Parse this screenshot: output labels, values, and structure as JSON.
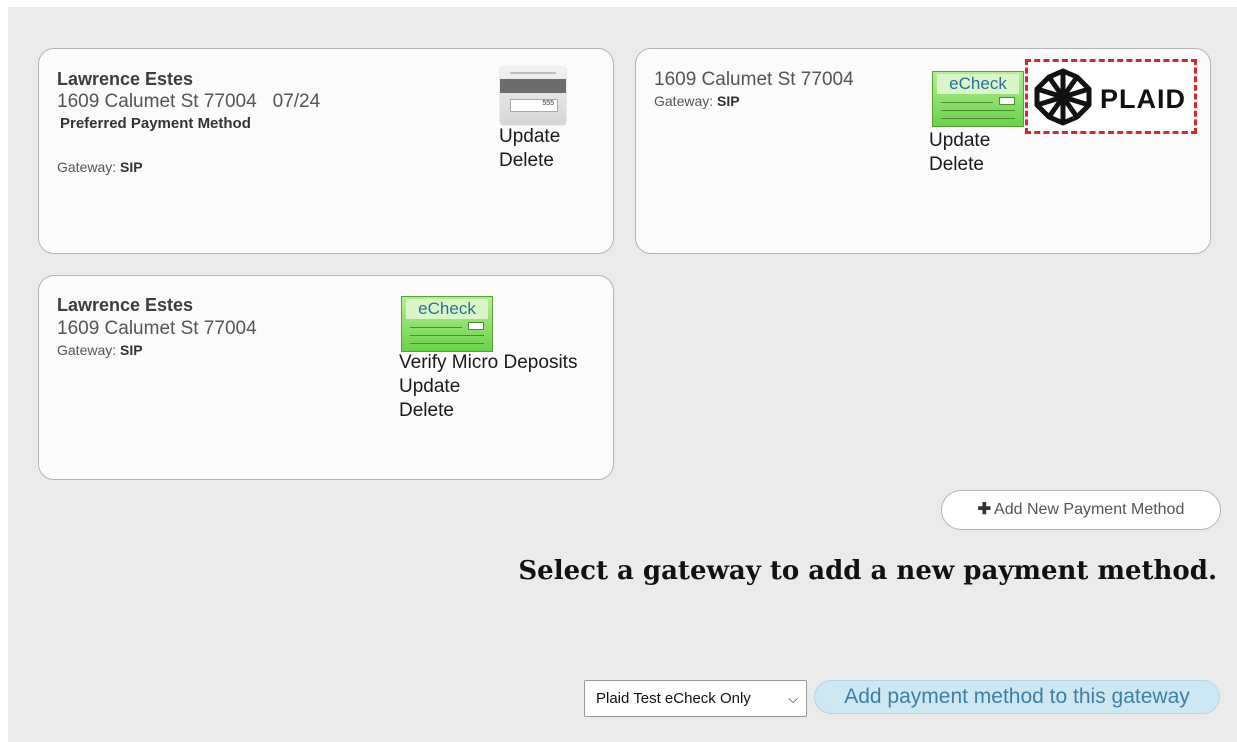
{
  "cards": [
    {
      "name": "Lawrence Estes",
      "address": "1609 Calumet St 77004",
      "expiry": "07/24",
      "preferred": "Preferred Payment Method",
      "gateway_label": "Gateway:",
      "gateway": "SIP",
      "icon": "credit-card-back-icon",
      "cvv_text": "555",
      "actions": [
        "Update",
        "Delete"
      ]
    },
    {
      "address": "1609 Calumet St 77004",
      "gateway_label": "Gateway:",
      "gateway": "SIP",
      "icon": "echeck-icon",
      "icon_text": "eCheck",
      "actions": [
        "Update",
        "Delete"
      ],
      "logo": "PLAID"
    },
    {
      "name": "Lawrence Estes",
      "address": "1609 Calumet St 77004",
      "gateway_label": "Gateway:",
      "gateway": "SIP",
      "icon": "echeck-icon",
      "icon_text": "eCheck",
      "actions": [
        "Verify Micro Deposits",
        "Update",
        "Delete"
      ]
    }
  ],
  "add_button": {
    "icon": "plus-icon",
    "label": "Add New Payment Method"
  },
  "gateway_section": {
    "heading": "Select a gateway to add a new payment method.",
    "select_value": "Plaid Test eCheck Only",
    "submit_label": "Add payment method to this gateway"
  },
  "colors": {
    "background": "#ebebeb",
    "card_bg": "#fcfafa",
    "accent_button_bg": "#cde8f3",
    "accent_button_text": "#3d7fa6",
    "highlight_dash": "#d02a2a"
  }
}
